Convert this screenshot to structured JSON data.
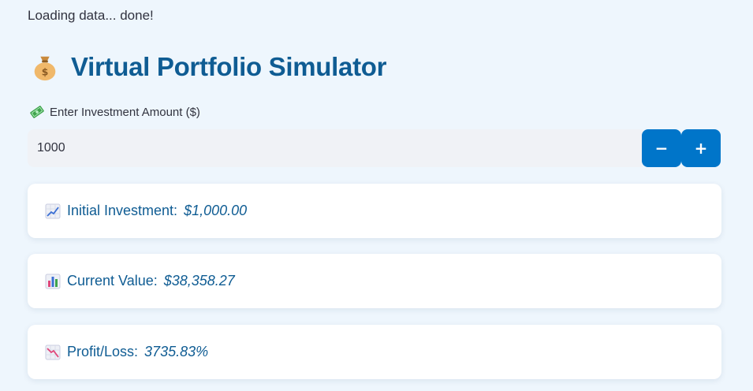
{
  "status": {
    "text": "Loading data... done!"
  },
  "header": {
    "title": "Virtual Portfolio Simulator",
    "icon": "money-bag-icon"
  },
  "investment_input": {
    "label": "Enter Investment Amount ($)",
    "label_icon": "dollar-banknote-icon",
    "value": "1000",
    "decrement_label": "−",
    "increment_label": "+"
  },
  "metrics": [
    {
      "icon": "chart-increasing-icon",
      "label": "Initial Investment:",
      "value": "$1,000.00"
    },
    {
      "icon": "bar-chart-icon",
      "label": "Current Value:",
      "value": "$38,358.27"
    },
    {
      "icon": "chart-decreasing-icon",
      "label": "Profit/Loss:",
      "value": "3735.83%"
    }
  ],
  "colors": {
    "background": "#eef6fd",
    "accent": "#0075c9",
    "title": "#0f5c93",
    "card": "#ffffff",
    "input": "#f0f2f6"
  }
}
